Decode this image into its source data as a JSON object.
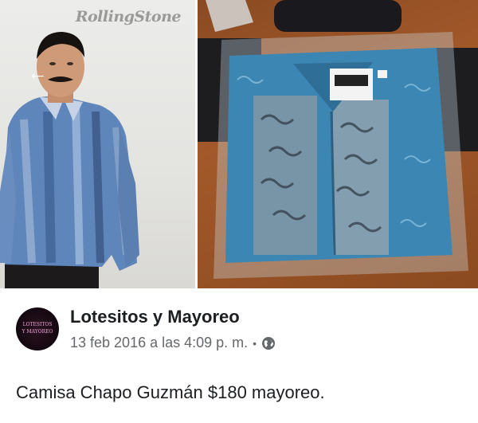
{
  "photos": {
    "left_watermark": "RollingStone",
    "back_icon": "back-arrow-icon"
  },
  "post": {
    "page_name": "Lotesitos y Mayoreo",
    "avatar_text_line1": "LOTESITOS",
    "avatar_text_line2": "Y MAYOREO",
    "timestamp": "13 feb 2016 a las 4:09 p. m.",
    "separator": "•",
    "privacy_icon": "globe-icon",
    "text": "Camisa Chapo Guzmán $180 mayoreo."
  }
}
